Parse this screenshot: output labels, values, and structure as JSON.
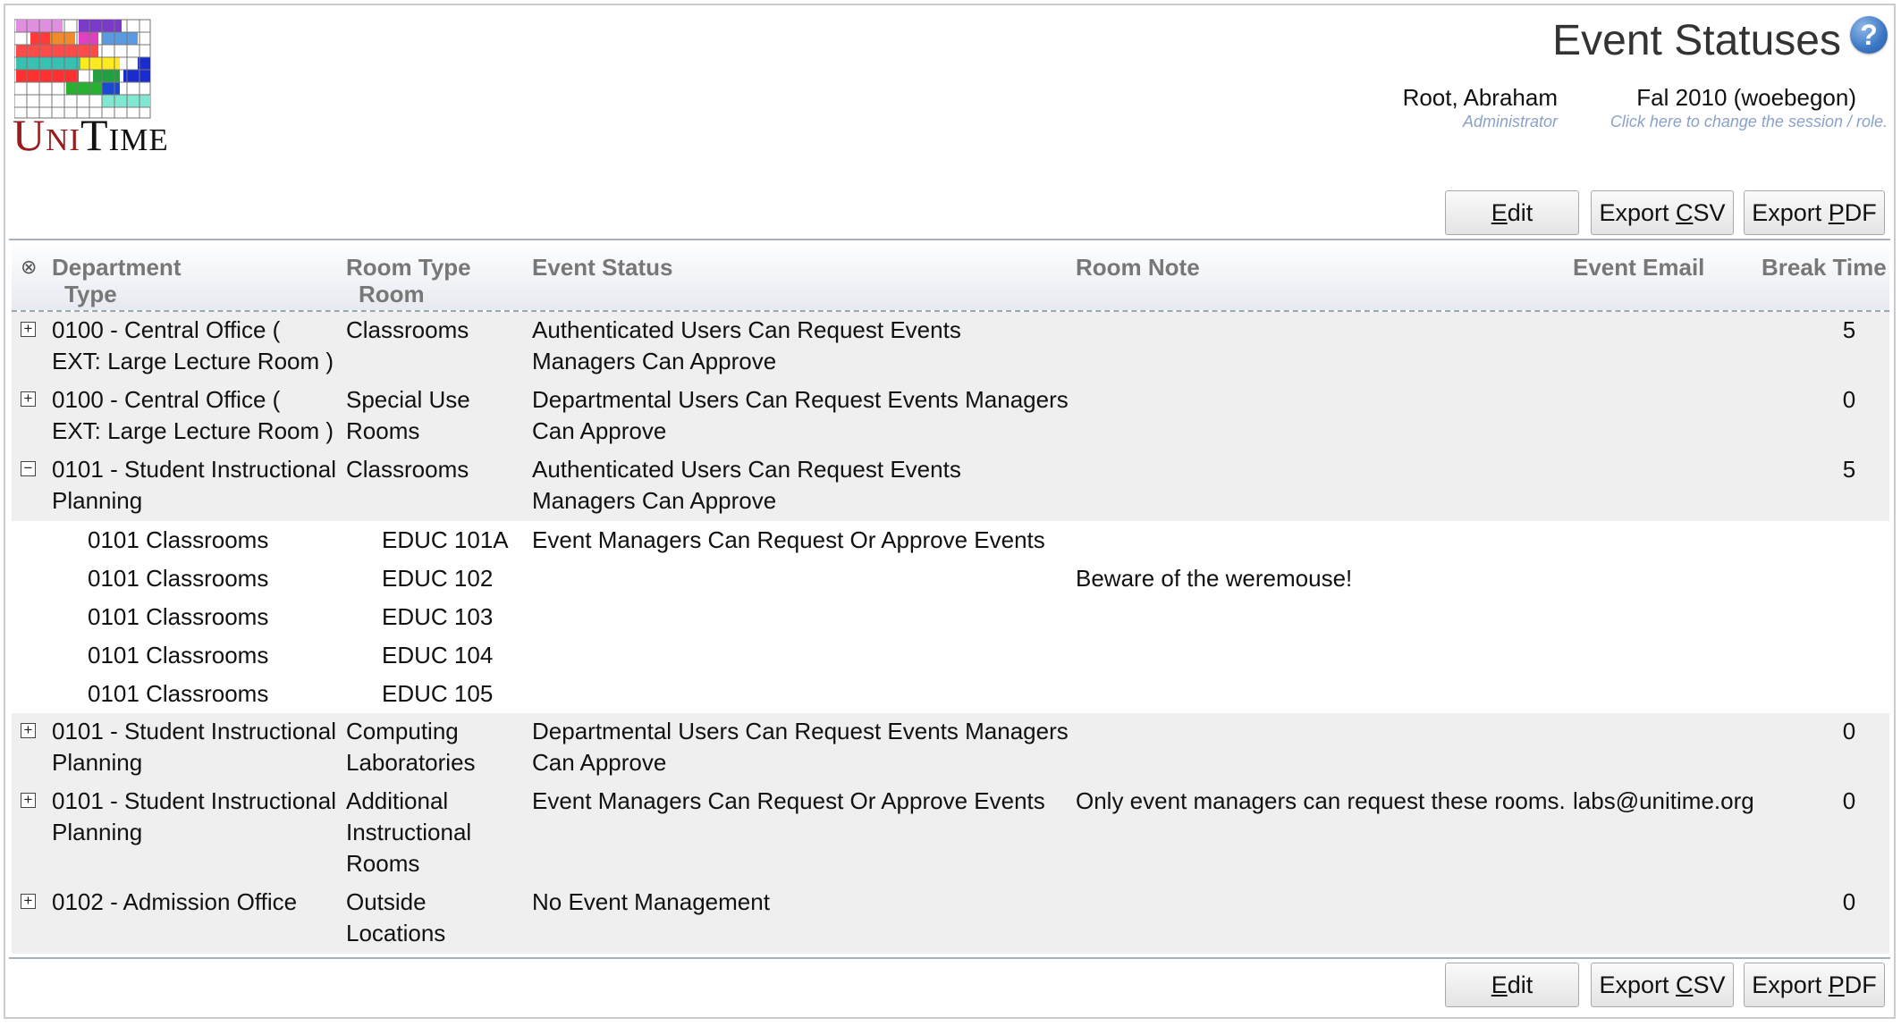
{
  "app": {
    "logo_text_1": "Uni",
    "logo_text_2": "Time",
    "page_title": "Event Statuses",
    "help_icon": "help-icon",
    "user_name": "Root, Abraham",
    "user_role": "Administrator",
    "session_name": "Fal 2010 (woebegon)",
    "session_hint": "Click here to change the session / role."
  },
  "buttons": {
    "edit": {
      "pre": "",
      "key": "E",
      "post": "dit"
    },
    "export_csv": {
      "pre": "Export ",
      "key": "C",
      "post": "SV"
    },
    "export_pdf": {
      "pre": "Export ",
      "key": "P",
      "post": "DF"
    }
  },
  "table": {
    "collapse_all_icon": "⊗",
    "headers": {
      "department": "Department",
      "type": "Type",
      "room_type": "Room Type",
      "room": "Room",
      "event_status": "Event Status",
      "room_note": "Room Note",
      "event_email": "Event Email",
      "break_time": "Break Time"
    },
    "rows": [
      {
        "kind": "group",
        "toggle": "+",
        "dept": [
          "0100 - Central Office (",
          "EXT: Large Lecture Room )"
        ],
        "rtype": [
          "Classrooms"
        ],
        "status": [
          "Authenticated Users Can Request Events",
          "Managers Can Approve"
        ],
        "note": "",
        "email": "",
        "brk": "5"
      },
      {
        "kind": "group",
        "toggle": "+",
        "dept": [
          "0100 - Central Office (",
          "EXT: Large Lecture Room )"
        ],
        "rtype": [
          "Special Use",
          "Rooms"
        ],
        "status": [
          "Departmental Users Can Request Events Managers",
          "Can Approve"
        ],
        "note": "",
        "email": "",
        "brk": "0"
      },
      {
        "kind": "group",
        "toggle": "−",
        "dept": [
          "0101 - Student Instructional",
          "Planning"
        ],
        "rtype": [
          "Classrooms"
        ],
        "status": [
          "Authenticated Users Can Request Events",
          "Managers Can Approve"
        ],
        "note": "",
        "email": "",
        "brk": "5"
      },
      {
        "kind": "child",
        "type": "0101 Classrooms",
        "room": "EDUC 101A",
        "status": "Event Managers Can Request Or Approve Events",
        "note": ""
      },
      {
        "kind": "child",
        "type": "0101 Classrooms",
        "room": "EDUC 102",
        "status": "",
        "note": "Beware of the weremouse!"
      },
      {
        "kind": "child",
        "type": "0101 Classrooms",
        "room": "EDUC 103",
        "status": "",
        "note": ""
      },
      {
        "kind": "child",
        "type": "0101 Classrooms",
        "room": "EDUC 104",
        "status": "",
        "note": ""
      },
      {
        "kind": "child",
        "type": "0101 Classrooms",
        "room": "EDUC 105",
        "status": "",
        "note": ""
      },
      {
        "kind": "group",
        "toggle": "+",
        "dept": [
          "0101 - Student Instructional",
          "Planning"
        ],
        "rtype": [
          "Computing",
          "Laboratories"
        ],
        "status": [
          "Departmental Users Can Request Events Managers",
          "Can Approve"
        ],
        "note": "",
        "email": "",
        "brk": "0"
      },
      {
        "kind": "group",
        "toggle": "+",
        "dept": [
          "0101 - Student Instructional",
          "Planning"
        ],
        "rtype": [
          "Additional",
          "Instructional",
          "Rooms"
        ],
        "status": [
          "Event Managers Can Request Or Approve Events"
        ],
        "note": "Only event managers can request these rooms.",
        "email": "labs@unitime.org",
        "brk": "0"
      },
      {
        "kind": "group",
        "toggle": "+",
        "dept": [
          "0102 - Admission Office"
        ],
        "rtype": [
          "Outside",
          "Locations"
        ],
        "status": [
          "No Event Management"
        ],
        "note": "",
        "email": "",
        "brk": "0"
      }
    ]
  }
}
